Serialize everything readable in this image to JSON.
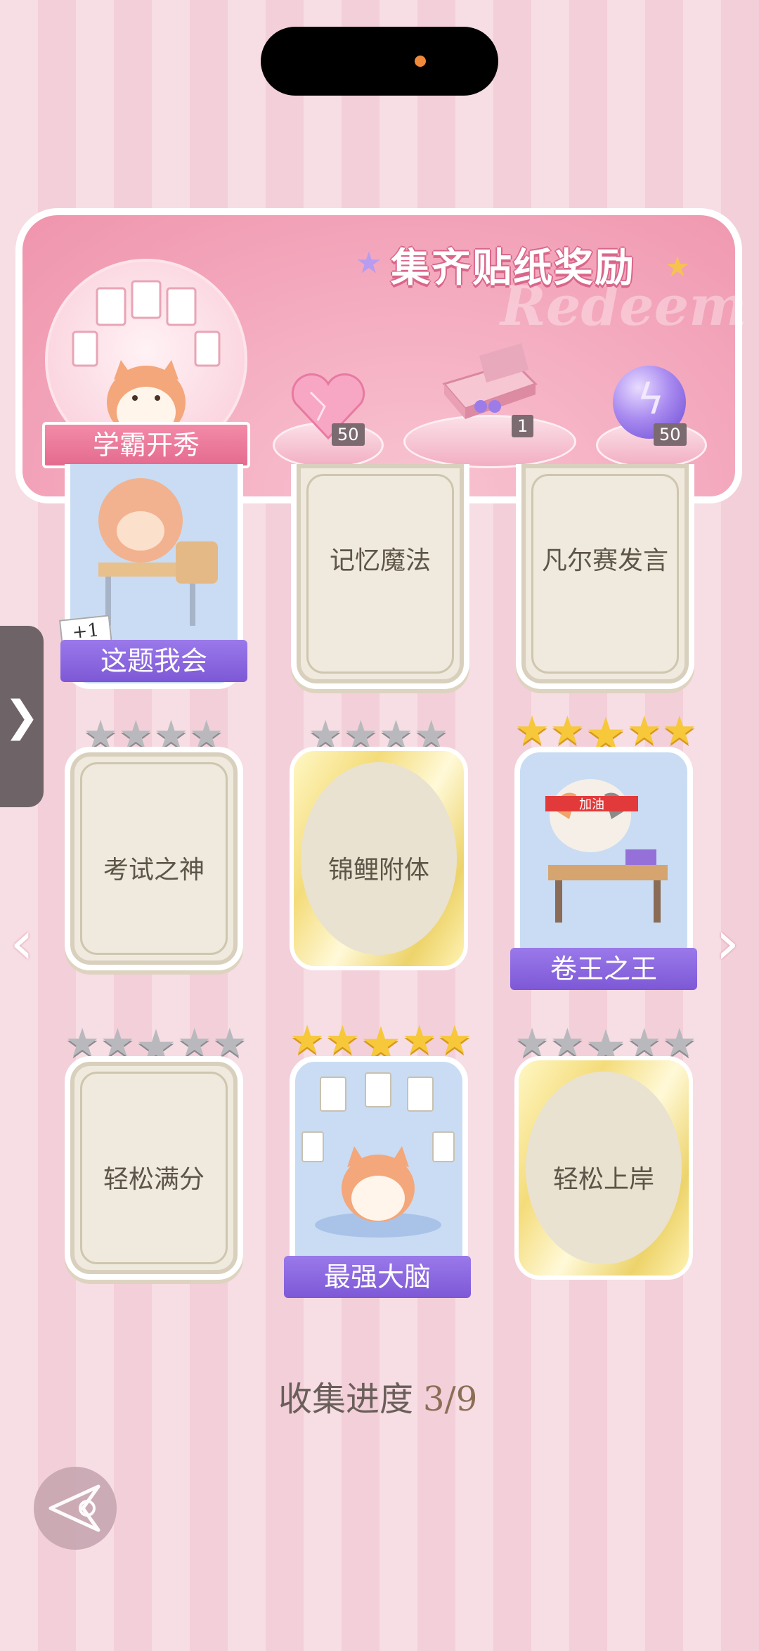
{
  "banner": {
    "title": "集齐贴纸奖励",
    "watermark": "Redeem",
    "hero_label": "学霸开秀",
    "rewards": [
      {
        "icon": "pink-heart-gem-icon",
        "count": "50"
      },
      {
        "icon": "gift-box-icon",
        "count": "1"
      },
      {
        "icon": "purple-energy-orb-icon",
        "count": "50"
      }
    ]
  },
  "stickers": [
    {
      "label": "这题我会",
      "state": "collected",
      "bonus": "+1"
    },
    {
      "label": "记忆魔法",
      "state": "locked"
    },
    {
      "label": "凡尔赛发言",
      "state": "locked"
    },
    {
      "label": "考试之神",
      "state": "locked",
      "stars_filled": 0,
      "stars_total": 4
    },
    {
      "label": "锦鲤附体",
      "state": "locked",
      "stars_filled": 0,
      "stars_total": 4
    },
    {
      "label": "卷王之王",
      "state": "collected",
      "stars_filled": 5,
      "stars_total": 5
    },
    {
      "label": "轻松满分",
      "state": "locked",
      "stars_filled": 0,
      "stars_total": 5
    },
    {
      "label": "最强大脑",
      "state": "collected",
      "stars_filled": 5,
      "stars_total": 5
    },
    {
      "label": "轻松上岸",
      "state": "locked",
      "stars_filled": 0,
      "stars_total": 5
    }
  ],
  "progress": {
    "label": "收集进度",
    "value": "3/9"
  },
  "cat_headband_text": "加油",
  "colors": {
    "accent_purple": "#8a68e0",
    "gold_star": "#f6c83a",
    "pink_bg": "#f7dde4"
  }
}
